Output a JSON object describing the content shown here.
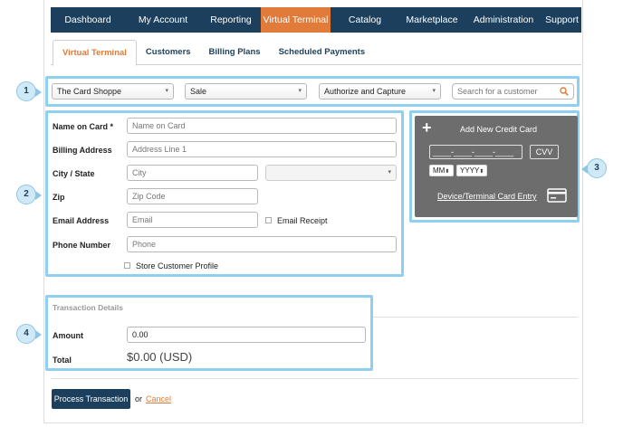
{
  "nav": {
    "items": [
      "Dashboard",
      "My Account",
      "Reporting",
      "Virtual Terminal",
      "Catalog",
      "Marketplace",
      "Administration",
      "Support"
    ],
    "active_index": 3
  },
  "tabs": [
    "Virtual Terminal",
    "Customers",
    "Billing Plans",
    "Scheduled Payments"
  ],
  "filters": {
    "merchant": "The Card Shoppe",
    "type": "Sale",
    "mode": "Authorize and Capture",
    "search_placeholder": "Search for a customer"
  },
  "form": {
    "name_label": "Name on Card *",
    "name_placeholder": "Name on Card",
    "billing_label": "Billing Address",
    "billing_placeholder": "Address Line 1",
    "city_label": "City / State",
    "city_placeholder": "City",
    "zip_label": "Zip",
    "zip_placeholder": "Zip Code",
    "email_label": "Email Address",
    "email_placeholder": "Email",
    "email_receipt": "Email Receipt",
    "phone_label": "Phone Number",
    "phone_placeholder": "Phone",
    "store_profile": "Store Customer Profile"
  },
  "card": {
    "title": "Add New Credit Card",
    "number_placeholder": "____-____-____-____",
    "cvv": "CVV",
    "month": "MM",
    "year": "YYYY",
    "device_link": "Device/Terminal Card Entry"
  },
  "transaction": {
    "header": "Transaction Details",
    "amount_label": "Amount",
    "amount_value": "0.00",
    "total_label": "Total",
    "total_value": "$0.00 (USD)"
  },
  "actions": {
    "process": "Process Transaction",
    "or": "or",
    "cancel": "Cancel"
  },
  "markers": [
    "1",
    "2",
    "3",
    "4"
  ],
  "colors": {
    "navy": "#1b3f5c",
    "accent": "#e07b39",
    "highlight": "#8fd0f0"
  }
}
